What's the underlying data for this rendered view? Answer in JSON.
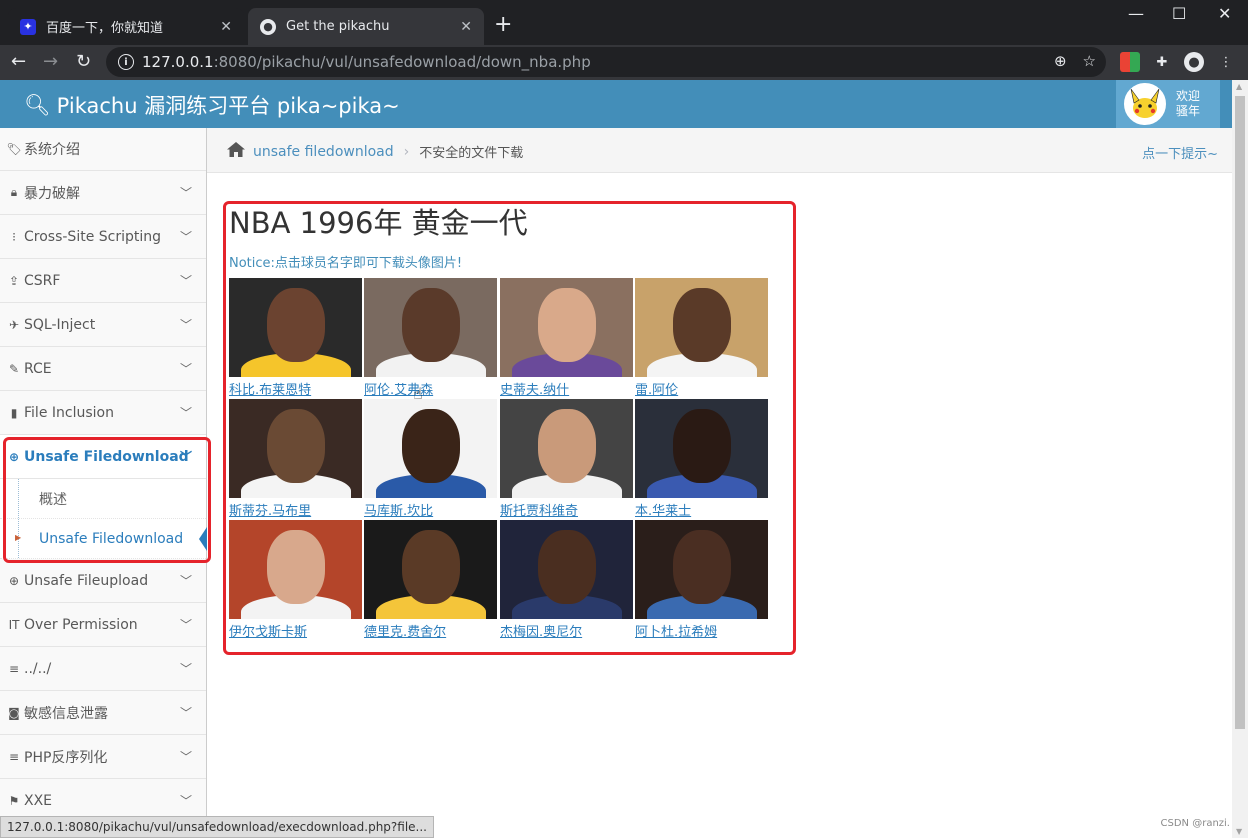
{
  "browser": {
    "tabs": [
      {
        "title": "百度一下，你就知道",
        "icon": "baidu-paw-icon"
      },
      {
        "title": "Get the pikachu",
        "icon": "globe-icon"
      }
    ],
    "url_host": "127.0.0.1",
    "url_rest": ":8080/pikachu/vul/unsafedownload/down_nba.php"
  },
  "header": {
    "title": "Pikachu 漏洞练习平台 pika~pika~",
    "welcome_line1": "欢迎",
    "welcome_line2": "骚年"
  },
  "sidebar": {
    "items": [
      {
        "label": "系统介绍",
        "icon": "tags-icon"
      },
      {
        "label": "暴力破解",
        "icon": "lock-icon"
      },
      {
        "label": "Cross-Site Scripting",
        "icon": "list-icon"
      },
      {
        "label": "CSRF",
        "icon": "share-icon"
      },
      {
        "label": "SQL-Inject",
        "icon": "fighter-jet-icon"
      },
      {
        "label": "RCE",
        "icon": "pencil-icon"
      },
      {
        "label": "File Inclusion",
        "icon": "file-icon"
      },
      {
        "label": "Unsafe Filedownload",
        "icon": "download-circle-icon"
      },
      {
        "label": "Unsafe Fileupload",
        "icon": "upload-circle-icon"
      },
      {
        "label": "Over Permission",
        "icon": "text-height-icon"
      },
      {
        "label": "../../",
        "icon": "align-left-icon"
      },
      {
        "label": "敏感信息泄露",
        "icon": "camera-icon"
      },
      {
        "label": "PHP反序列化",
        "icon": "align-justify-icon"
      },
      {
        "label": "XXE",
        "icon": "flag-icon"
      }
    ],
    "subitems": [
      {
        "label": "概述"
      },
      {
        "label": "Unsafe Filedownload"
      }
    ]
  },
  "breadcrumb": {
    "link": "unsafe filedownload",
    "current": "不安全的文件下载",
    "hint": "点一下提示~"
  },
  "main": {
    "title": "NBA 1996年 黄金一代",
    "notice": "Notice:点击球员名字即可下载头像图片!",
    "players": [
      {
        "name": "科比.布莱恩特",
        "bg": "#2a2a2a",
        "skin": "#6b4330",
        "jersey": "#f5c52b"
      },
      {
        "name": "阿伦.艾弗森",
        "bg": "#7a6a60",
        "skin": "#5a3a2a",
        "jersey": "#f2f2f2"
      },
      {
        "name": "史蒂夫.纳什",
        "bg": "#8a7060",
        "skin": "#d9a98a",
        "jersey": "#6a4a9a"
      },
      {
        "name": "雷.阿伦",
        "bg": "#c8a26a",
        "skin": "#5a3a28",
        "jersey": "#f4f4f4"
      },
      {
        "name": "斯蒂芬.马布里",
        "bg": "#3a2a24",
        "skin": "#6a4a34",
        "jersey": "#f4f4f4"
      },
      {
        "name": "马库斯.坎比",
        "bg": "#f3f3f3",
        "skin": "#3a2418",
        "jersey": "#2a5aa8"
      },
      {
        "name": "斯托贾科维奇",
        "bg": "#444444",
        "skin": "#c99a7a",
        "jersey": "#f1f1f1"
      },
      {
        "name": "本.华莱士",
        "bg": "#2a2f3a",
        "skin": "#2a1a14",
        "jersey": "#3a5ab0"
      },
      {
        "name": "伊尔戈斯卡斯",
        "bg": "#b4452a",
        "skin": "#d8a88c",
        "jersey": "#f3f3f3"
      },
      {
        "name": "德里克.费舍尔",
        "bg": "#1a1a1a",
        "skin": "#5a3a26",
        "jersey": "#f4c53a"
      },
      {
        "name": "杰梅因.奥尼尔",
        "bg": "#20243a",
        "skin": "#4a2e20",
        "jersey": "#2a3a6a"
      },
      {
        "name": "阿卜杜.拉希姆",
        "bg": "#2a1e1a",
        "skin": "#4a2e22",
        "jersey": "#3a6ab0"
      }
    ]
  },
  "statusbar": "127.0.0.1:8080/pikachu/vul/unsafedownload/execdownload.php?file...",
  "watermark": "CSDN @ranzi."
}
